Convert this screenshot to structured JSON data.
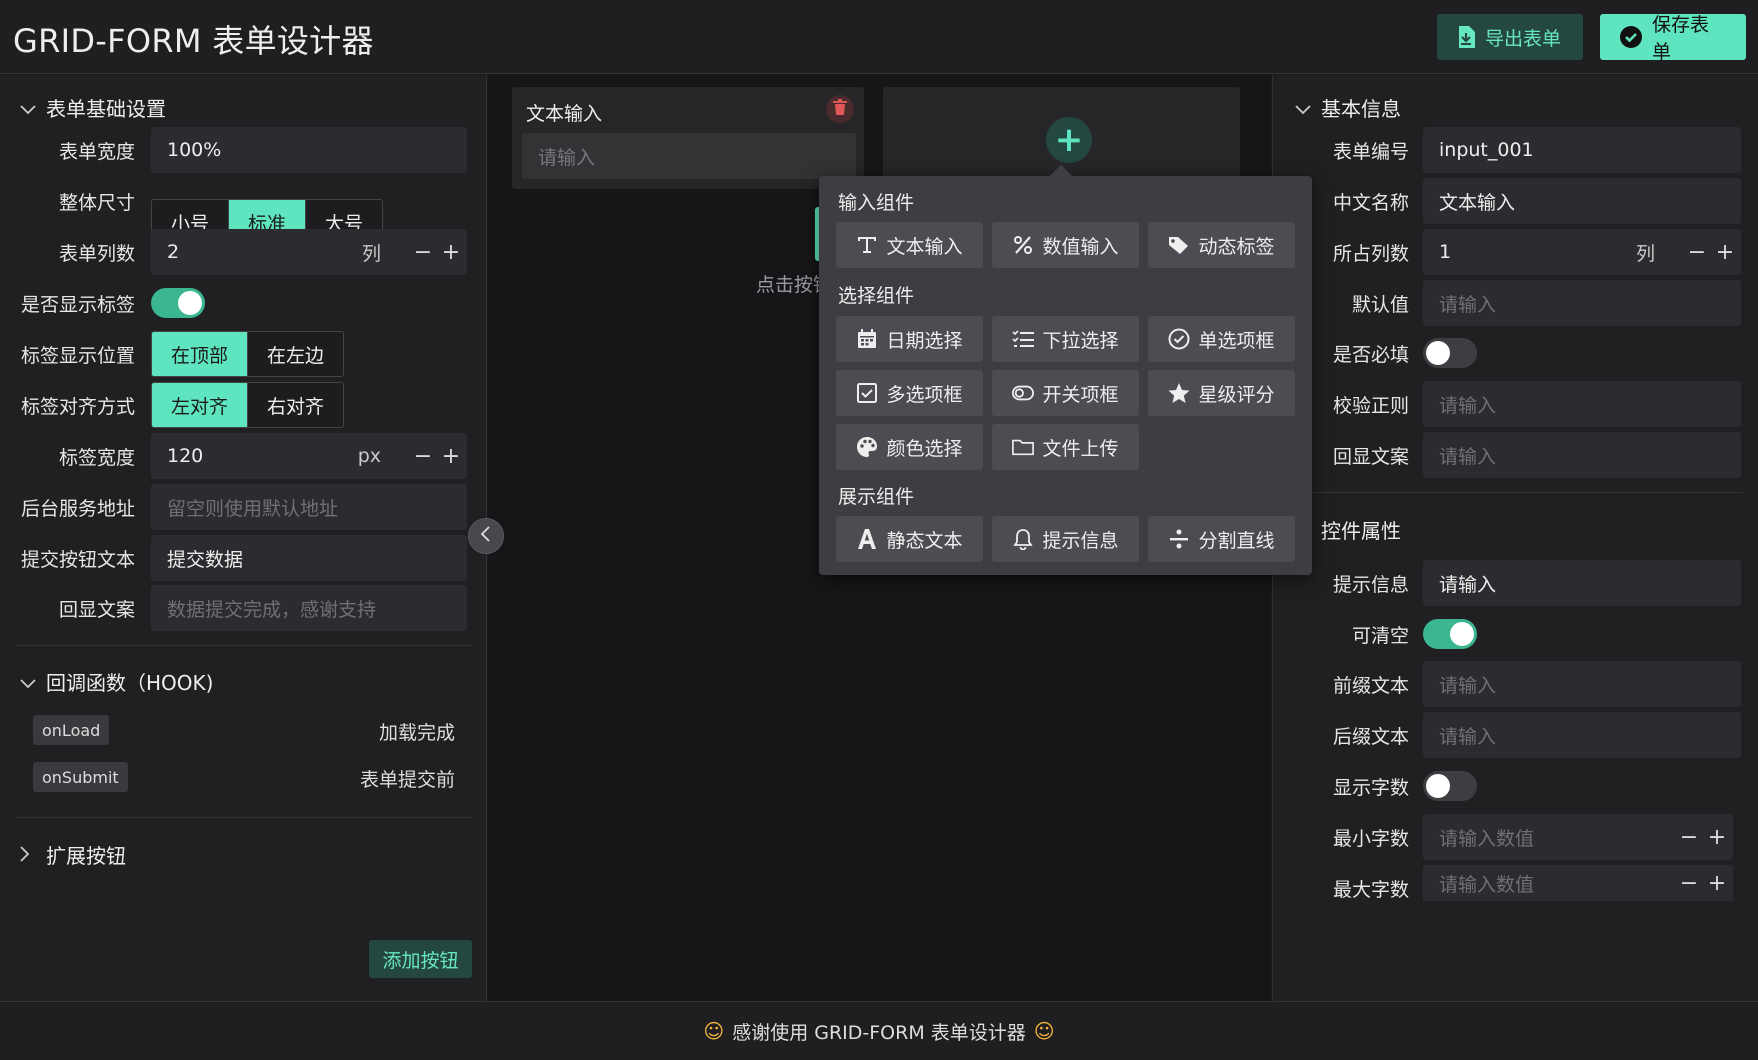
{
  "header": {
    "title": "GRID-FORM 表单设计器",
    "export_label": "导出表单",
    "save_label": "保存表单"
  },
  "left": {
    "section_basic": "表单基础设置",
    "form_width": {
      "label": "表单宽度",
      "value": "100%"
    },
    "size": {
      "label": "整体尺寸",
      "options": [
        "小号",
        "标准",
        "大号"
      ],
      "selected": "标准"
    },
    "columns": {
      "label": "表单列数",
      "value": "2",
      "unit": "列"
    },
    "show_label": {
      "label": "是否显示标签",
      "on": true
    },
    "label_position": {
      "label": "标签显示位置",
      "options": [
        "在顶部",
        "在左边"
      ],
      "selected": "在顶部"
    },
    "label_align": {
      "label": "标签对齐方式",
      "options": [
        "左对齐",
        "右对齐"
      ],
      "selected": "左对齐"
    },
    "label_width": {
      "label": "标签宽度",
      "value": "120",
      "unit": "px"
    },
    "server_url": {
      "label": "后台服务地址",
      "placeholder": "留空则使用默认地址"
    },
    "submit_text": {
      "label": "提交按钮文本",
      "value": "提交数据"
    },
    "echo_text": {
      "label": "回显文案",
      "placeholder": "数据提交完成，感谢支持"
    },
    "section_hook": "回调函数（HOOK)",
    "hooks": [
      {
        "name": "onLoad",
        "desc": "加载完成"
      },
      {
        "name": "onSubmit",
        "desc": "表单提交前"
      }
    ],
    "section_ext": "扩展按钮",
    "add_button_label": "添加按钮"
  },
  "center": {
    "card_title": "文本输入",
    "card_placeholder": "请输入",
    "hint_fragment": "点击按钮"
  },
  "popup": {
    "groups": [
      {
        "title": "输入组件",
        "items": [
          {
            "label": "文本输入",
            "icon": "text-input-icon"
          },
          {
            "label": "数值输入",
            "icon": "percent-icon"
          },
          {
            "label": "动态标签",
            "icon": "tag-icon"
          }
        ]
      },
      {
        "title": "选择组件",
        "items": [
          {
            "label": "日期选择",
            "icon": "calendar-icon"
          },
          {
            "label": "下拉选择",
            "icon": "list-icon"
          },
          {
            "label": "单选项框",
            "icon": "radio-check-icon"
          },
          {
            "label": "多选项框",
            "icon": "checkbox-icon"
          },
          {
            "label": "开关项框",
            "icon": "toggle-icon"
          },
          {
            "label": "星级评分",
            "icon": "star-icon"
          },
          {
            "label": "颜色选择",
            "icon": "palette-icon"
          },
          {
            "label": "文件上传",
            "icon": "folder-icon"
          }
        ]
      },
      {
        "title": "展示组件",
        "items": [
          {
            "label": "静态文本",
            "icon": "font-icon"
          },
          {
            "label": "提示信息",
            "icon": "bell-icon"
          },
          {
            "label": "分割直线",
            "icon": "divide-icon"
          }
        ]
      }
    ]
  },
  "right": {
    "section_basic": "基本信息",
    "code": {
      "label": "表单编号",
      "value": "input_001"
    },
    "cn_name": {
      "label": "中文名称",
      "value": "文本输入"
    },
    "span": {
      "label": "所占列数",
      "value": "1",
      "unit": "列"
    },
    "default": {
      "label": "默认值",
      "placeholder": "请输入"
    },
    "required": {
      "label": "是否必填",
      "on": false
    },
    "regex": {
      "label": "校验正则",
      "placeholder": "请输入"
    },
    "echo": {
      "label": "回显文案",
      "placeholder": "请输入"
    },
    "section_props": "控件属性",
    "tip": {
      "label": "提示信息",
      "value": "请输入"
    },
    "clearable": {
      "label": "可清空",
      "on": true
    },
    "prefix": {
      "label": "前缀文本",
      "placeholder": "请输入"
    },
    "suffix": {
      "label": "后缀文本",
      "placeholder": "请输入"
    },
    "show_count": {
      "label": "显示字数",
      "on": false
    },
    "min_len": {
      "label": "最小字数",
      "placeholder": "请输入数值"
    },
    "max_len": {
      "label": "最大字数",
      "placeholder": "请输入数值"
    }
  },
  "footer": {
    "text": "感谢使用 GRID-FORM 表单设计器"
  },
  "colors": {
    "accent": "#5ee5bf",
    "accent_dark": "#254742",
    "bg": "#1a191b",
    "panel": "#202022"
  }
}
